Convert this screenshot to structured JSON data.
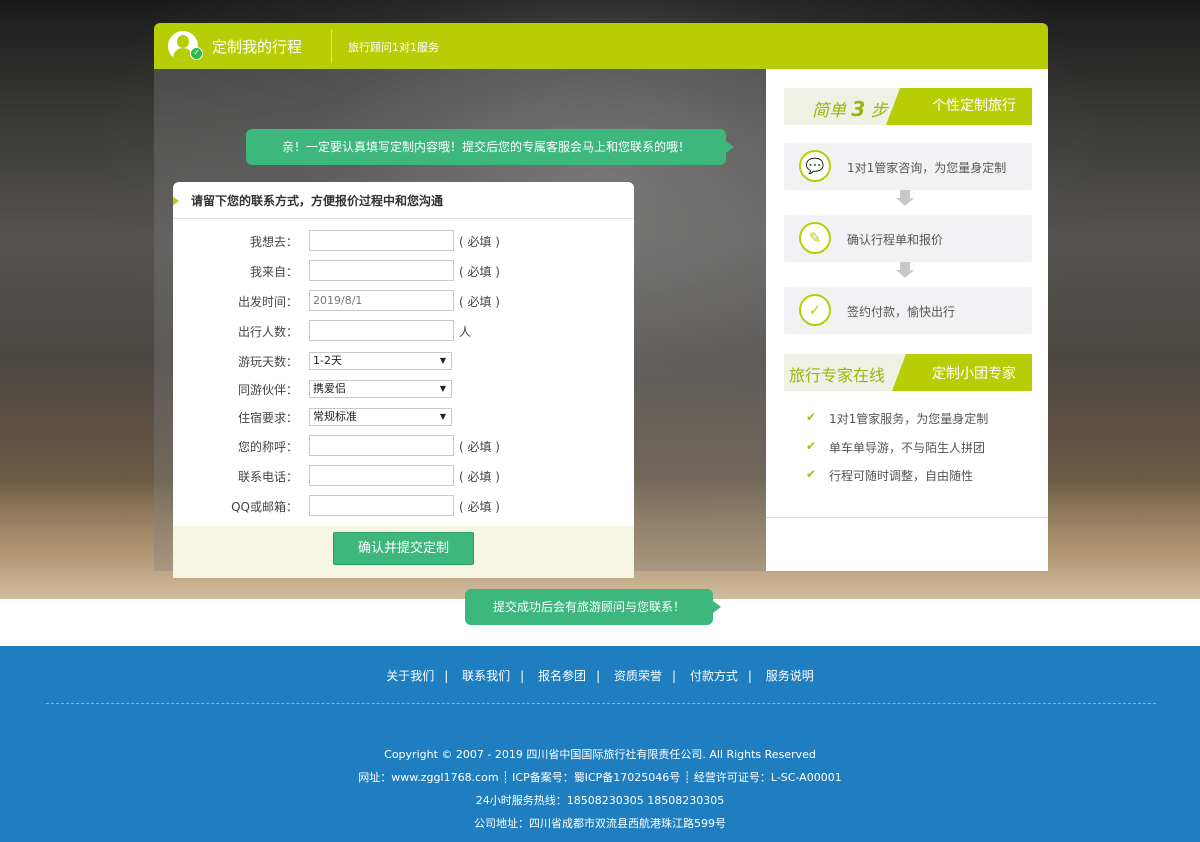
{
  "header": {
    "title": "定制我的行程",
    "subtitle": "旅行顾问1对1服务"
  },
  "notices": {
    "top": "亲！一定要认真填写定制内容哦！提交后您的专属客服会马上和您联系的哦！",
    "bottom": "提交成功后会有旅游顾问与您联系！"
  },
  "form": {
    "title": "请留下您的联系方式，方便报价过程中和您沟通",
    "required_note": "( 必填 )",
    "fields": [
      {
        "label": "我想去：",
        "value": "",
        "placeholder": ""
      },
      {
        "label": "我来自：",
        "value": "",
        "placeholder": ""
      },
      {
        "label": "出发时间：",
        "value": "",
        "placeholder": "2019/8/1"
      },
      {
        "label": "出行人数：",
        "value": "",
        "placeholder": "",
        "unit": "人"
      },
      {
        "label": "游玩天数：",
        "selected": "1-2天"
      },
      {
        "label": "同游伙伴：",
        "selected": "携爱侣"
      },
      {
        "label": "住宿要求：",
        "selected": "常规标准"
      },
      {
        "label": "您的称呼：",
        "value": "",
        "placeholder": ""
      },
      {
        "label": "联系电话：",
        "value": "",
        "placeholder": ""
      },
      {
        "label": "QQ或邮箱：",
        "value": "",
        "placeholder": ""
      }
    ],
    "submit_label": "确认并提交定制"
  },
  "steps": {
    "banner_left": "简单",
    "banner_num": "3",
    "banner_suffix": "步",
    "banner_right": "个性定制旅行",
    "items": [
      {
        "text": "1对1管家咨询，为您量身定制",
        "icon": "chat-bubble-icon"
      },
      {
        "text": "确认行程单和报价",
        "icon": "edit-icon"
      },
      {
        "text": "签约付款，愉快出行",
        "icon": "check-icon"
      }
    ]
  },
  "expert": {
    "banner_left": "旅行专家在线",
    "banner_right": "定制小团专家",
    "features": [
      "1对1管家服务，为您量身定制",
      "单车单导游，不与陌生人拼团",
      "行程可随时调整，自由随性"
    ]
  },
  "footer": {
    "nav": [
      "关于我们",
      "联系我们",
      "报名参团",
      "资质荣誉",
      "付款方式",
      "服务说明"
    ],
    "separator": "|",
    "copyright": "Copyright © 2007 - 2019 四川省中国国际旅行社有限责任公司. All Rights Reserved",
    "site_line": "网址：www.zggl1768.com ┊ ICP备案号：蜀ICP备17025046号 ┊ 经营许可证号：L-SC-A00001",
    "hotline": "24小时服务热线：18508230305  18508230305",
    "address": "公司地址：四川省成都市双流县西航港珠江路599号"
  },
  "colors": {
    "accent": "#b7ce07",
    "button": "#3db77c",
    "footer_bg": "#1f7ec0"
  }
}
